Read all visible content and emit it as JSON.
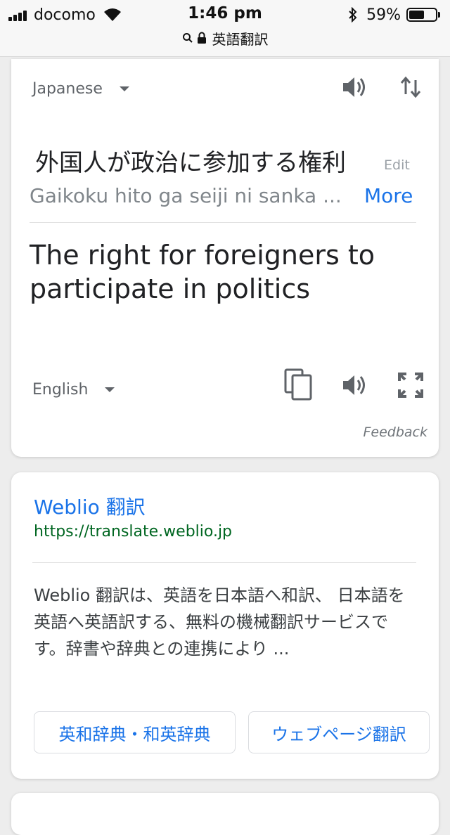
{
  "status_bar": {
    "carrier": "docomo",
    "time": "1:46 pm",
    "battery": "59%",
    "battery_level": 0.59,
    "url": "英語翻訳"
  },
  "translate_card": {
    "source_language": "Japanese",
    "source_text": "外国人が政治に参加する権利",
    "edit_label": "Edit",
    "romanization": "Gaikoku hito ga seiji ni sanka ...",
    "more_label": "More",
    "translated_text": "The right for foreigners to participate in politics",
    "target_language": "English",
    "feedback_label": "Feedback"
  },
  "result": {
    "title": "Weblio 翻訳",
    "url": "https://translate.weblio.jp",
    "snippet": "Weblio 翻訳は、英語を日本語へ和訳、 日本語を英語へ英語訳する、無料の機械翻訳サービスです。辞書や辞典との連携により ...",
    "sitelinks": [
      "英和辞典・和英辞典",
      "ウェブページ翻訳"
    ]
  },
  "colors": {
    "link_blue": "#1a73e8",
    "url_green": "#006621",
    "page_background": "#ededed"
  },
  "icons": [
    "signal-icon",
    "wifi-icon",
    "bluetooth-icon",
    "battery-icon",
    "search-icon",
    "lock-icon",
    "speaker-icon",
    "swap-icon",
    "copy-icon",
    "expand-icon"
  ]
}
